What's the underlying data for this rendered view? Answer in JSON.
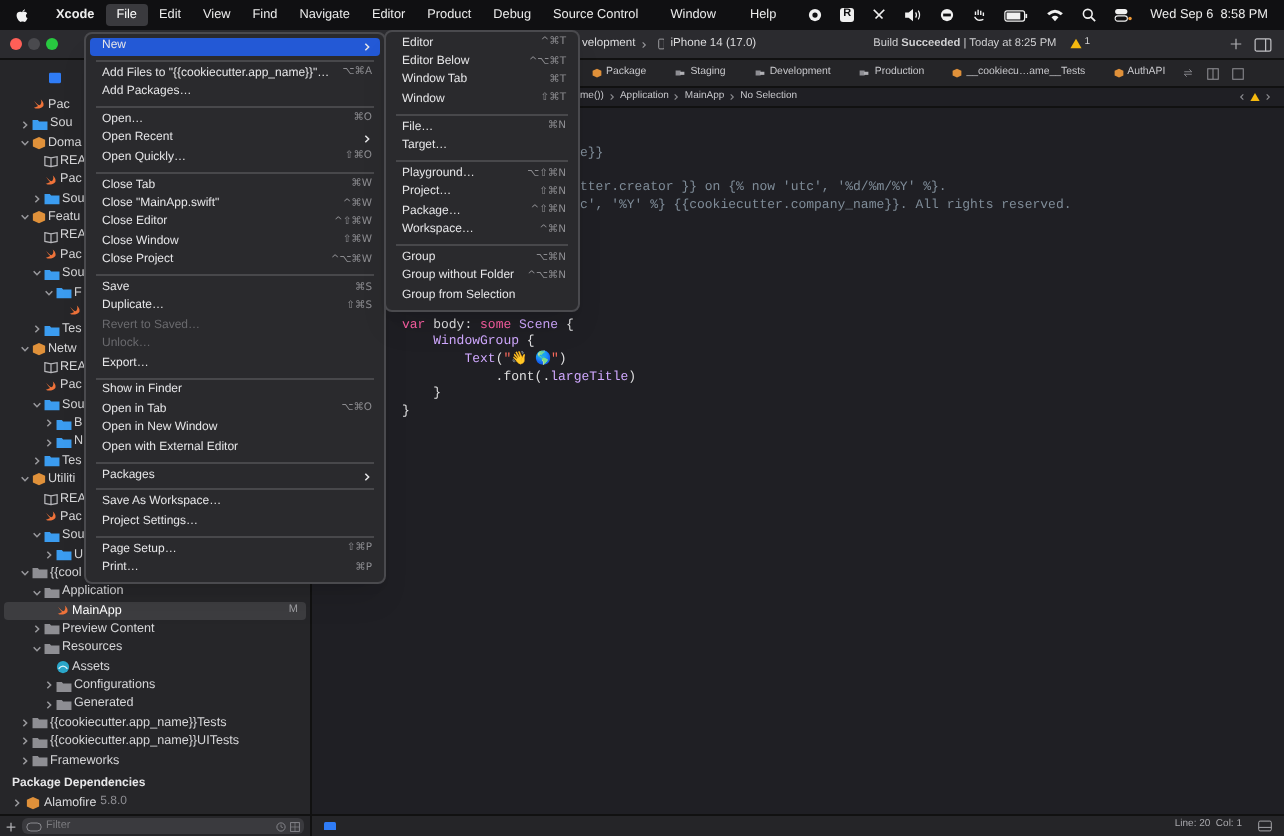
{
  "menubar": {
    "items": [
      {
        "label": "Xcode",
        "kind": "app",
        "selected": false
      },
      {
        "label": "File",
        "kind": "menu",
        "selected": true
      },
      {
        "label": "Edit",
        "kind": "menu",
        "selected": false
      },
      {
        "label": "View",
        "kind": "menu",
        "selected": false
      },
      {
        "label": "Find",
        "kind": "menu",
        "selected": false
      },
      {
        "label": "Navigate",
        "kind": "menu",
        "selected": false
      },
      {
        "label": "Editor",
        "kind": "menu",
        "selected": false
      },
      {
        "label": "Product",
        "kind": "menu",
        "selected": false
      },
      {
        "label": "Debug",
        "kind": "menu",
        "selected": false
      },
      {
        "label": "Source Control",
        "kind": "menu",
        "selected": false
      }
    ],
    "right_items": [
      "Window",
      "Help"
    ],
    "status_badge": "R",
    "clock": "Wed Sep 6  8:58 PM"
  },
  "toolbar": {
    "scheme": "velopment",
    "device": "iPhone 14 (17.0)",
    "build_status": "Build **Succeeded** | Today at 8:25 PM",
    "warnings": "1"
  },
  "file_menu": [
    {
      "kind": "item",
      "label": "New",
      "submenu": true,
      "disabled": false,
      "selected": true
    },
    {
      "kind": "separator"
    },
    {
      "kind": "item",
      "label": "Add Files to \"{{cookiecutter.app_name}}\"…",
      "shortcut": "⌥⌘A",
      "submenu": false,
      "disabled": false,
      "selected": false
    },
    {
      "kind": "item",
      "label": "Add Packages…",
      "submenu": false,
      "disabled": false,
      "selected": false
    },
    {
      "kind": "separator"
    },
    {
      "kind": "item",
      "label": "Open…",
      "shortcut": "⌘O",
      "submenu": false,
      "disabled": false,
      "selected": false
    },
    {
      "kind": "item",
      "label": "Open Recent",
      "submenu": true,
      "disabled": false,
      "selected": false
    },
    {
      "kind": "item",
      "label": "Open Quickly…",
      "shortcut": "⇧⌘O",
      "submenu": false,
      "disabled": false,
      "selected": false
    },
    {
      "kind": "separator"
    },
    {
      "kind": "item",
      "label": "Close Tab",
      "shortcut": "⌘W",
      "submenu": false,
      "disabled": false,
      "selected": false
    },
    {
      "kind": "item",
      "label": "Close \"MainApp.swift\"",
      "shortcut": "^⌘W",
      "submenu": false,
      "disabled": false,
      "selected": false
    },
    {
      "kind": "item",
      "label": "Close Editor",
      "shortcut": "^⇧⌘W",
      "submenu": false,
      "disabled": false,
      "selected": false
    },
    {
      "kind": "item",
      "label": "Close Window",
      "shortcut": "⇧⌘W",
      "submenu": false,
      "disabled": false,
      "selected": false
    },
    {
      "kind": "item",
      "label": "Close Project",
      "shortcut": "^⌥⌘W",
      "submenu": false,
      "disabled": false,
      "selected": false
    },
    {
      "kind": "separator"
    },
    {
      "kind": "item",
      "label": "Save",
      "shortcut": "⌘S",
      "submenu": false,
      "disabled": false,
      "selected": false
    },
    {
      "kind": "item",
      "label": "Duplicate…",
      "shortcut": "⇧⌘S",
      "submenu": false,
      "disabled": false,
      "selected": false
    },
    {
      "kind": "item",
      "label": "Revert to Saved…",
      "submenu": false,
      "disabled": true,
      "selected": false
    },
    {
      "kind": "item",
      "label": "Unlock…",
      "submenu": false,
      "disabled": true,
      "selected": false
    },
    {
      "kind": "item",
      "label": "Export…",
      "submenu": false,
      "disabled": false,
      "selected": false
    },
    {
      "kind": "separator"
    },
    {
      "kind": "item",
      "label": "Show in Finder",
      "submenu": false,
      "disabled": false,
      "selected": false
    },
    {
      "kind": "item",
      "label": "Open in Tab",
      "shortcut": "⌥⌘O",
      "submenu": false,
      "disabled": false,
      "selected": false
    },
    {
      "kind": "item",
      "label": "Open in New Window",
      "submenu": false,
      "disabled": false,
      "selected": false
    },
    {
      "kind": "item",
      "label": "Open with External Editor",
      "submenu": false,
      "disabled": false,
      "selected": false
    },
    {
      "kind": "separator"
    },
    {
      "kind": "item",
      "label": "Packages",
      "submenu": true,
      "disabled": false,
      "selected": false
    },
    {
      "kind": "separator"
    },
    {
      "kind": "item",
      "label": "Save As Workspace…",
      "submenu": false,
      "disabled": false,
      "selected": false
    },
    {
      "kind": "item",
      "label": "Project Settings…",
      "submenu": false,
      "disabled": false,
      "selected": false
    },
    {
      "kind": "separator"
    },
    {
      "kind": "item",
      "label": "Page Setup…",
      "shortcut": "⇧⌘P",
      "submenu": false,
      "disabled": false,
      "selected": false
    },
    {
      "kind": "item",
      "label": "Print…",
      "shortcut": "⌘P",
      "submenu": false,
      "disabled": false,
      "selected": false
    }
  ],
  "new_submenu": [
    {
      "kind": "item",
      "label": "Editor",
      "shortcut": "^⌘T"
    },
    {
      "kind": "item",
      "label": "Editor Below",
      "shortcut": "^⌥⌘T"
    },
    {
      "kind": "item",
      "label": "Window Tab",
      "shortcut": "⌘T"
    },
    {
      "kind": "item",
      "label": "Window",
      "shortcut": "⇧⌘T"
    },
    {
      "kind": "separator"
    },
    {
      "kind": "item",
      "label": "File…",
      "shortcut": "⌘N"
    },
    {
      "kind": "item",
      "label": "Target…"
    },
    {
      "kind": "separator"
    },
    {
      "kind": "item",
      "label": "Playground…",
      "shortcut": "⌥⇧⌘N"
    },
    {
      "kind": "item",
      "label": "Project…",
      "shortcut": "⇧⌘N"
    },
    {
      "kind": "item",
      "label": "Package…",
      "shortcut": "^⇧⌘N"
    },
    {
      "kind": "item",
      "label": "Workspace…",
      "shortcut": "^⌘N"
    },
    {
      "kind": "separator"
    },
    {
      "kind": "item",
      "label": "Group",
      "shortcut": "⌥⌘N"
    },
    {
      "kind": "item",
      "label": "Group without Folder",
      "shortcut": "^⌥⌘N"
    },
    {
      "kind": "item",
      "label": "Group from Selection"
    }
  ],
  "navigator": {
    "tree": [
      {
        "label": "Pac",
        "kind": "swift",
        "selected": false
      },
      {
        "label": "Sou",
        "kind": "folder",
        "expanded": false,
        "selected": false
      },
      {
        "label": "Doma",
        "kind": "module",
        "expanded": true,
        "selected": false,
        "children": [
          {
            "label": "REA",
            "kind": "readme",
            "selected": false
          },
          {
            "label": "Pac",
            "kind": "swift",
            "selected": false
          },
          {
            "label": "Sou",
            "kind": "folder",
            "expanded": false,
            "selected": false
          }
        ]
      },
      {
        "label": "Featu",
        "kind": "module",
        "expanded": true,
        "selected": false,
        "children": [
          {
            "label": "REA",
            "kind": "readme",
            "selected": false
          },
          {
            "label": "Pac",
            "kind": "swift",
            "selected": false
          },
          {
            "label": "Sou",
            "kind": "folder",
            "expanded": true,
            "selected": false,
            "children": [
              {
                "label": "F",
                "kind": "folder",
                "expanded": true,
                "selected": false,
                "children": [
                  {
                    "kind": "swift",
                    "selected": false
                  }
                ]
              }
            ]
          },
          {
            "label": "Tes",
            "kind": "folder",
            "expanded": false,
            "selected": false
          }
        ]
      },
      {
        "label": "Netw",
        "kind": "module",
        "expanded": true,
        "selected": false,
        "children": [
          {
            "label": "REA",
            "kind": "readme",
            "selected": false
          },
          {
            "label": "Pac",
            "kind": "swift",
            "selected": false
          },
          {
            "label": "Sou",
            "kind": "folder",
            "expanded": true,
            "selected": false,
            "children": [
              {
                "label": "B",
                "kind": "folder",
                "expanded": false,
                "selected": false
              },
              {
                "label": "N",
                "kind": "folder",
                "expanded": false,
                "selected": false
              }
            ]
          },
          {
            "label": "Tes",
            "kind": "folder",
            "expanded": false,
            "selected": false
          }
        ]
      },
      {
        "label": "Utiliti",
        "kind": "module",
        "expanded": true,
        "selected": false,
        "children": [
          {
            "label": "REA",
            "kind": "readme",
            "selected": false
          },
          {
            "label": "Pac",
            "kind": "swift",
            "selected": false
          },
          {
            "label": "Sou",
            "kind": "folder",
            "expanded": true,
            "selected": false,
            "children": [
              {
                "label": "U",
                "kind": "folder",
                "expanded": false,
                "selected": false
              }
            ]
          }
        ]
      },
      {
        "label": "{{cool",
        "kind": "group",
        "expanded": true,
        "selected": false,
        "children": [
          {
            "label": "Application",
            "kind": "group",
            "expanded": true,
            "selected": false,
            "children": [
              {
                "label": "MainApp",
                "kind": "swift",
                "selected": true,
                "badge": "M"
              }
            ]
          },
          {
            "label": "Preview Content",
            "kind": "group",
            "expanded": false,
            "selected": false
          },
          {
            "label": "Resources",
            "kind": "group",
            "expanded": true,
            "selected": false,
            "children": [
              {
                "label": "Assets",
                "kind": "assets",
                "selected": false
              },
              {
                "label": "Configurations",
                "kind": "group",
                "expanded": false,
                "selected": false
              },
              {
                "label": "Generated",
                "kind": "group",
                "expanded": false,
                "selected": false
              }
            ]
          }
        ]
      },
      {
        "label": "{{cookiecutter.app_name}}Tests",
        "kind": "group",
        "expanded": false,
        "selected": false
      },
      {
        "label": "{{cookiecutter.app_name}}UITests",
        "kind": "group",
        "expanded": false,
        "selected": false
      },
      {
        "label": "Frameworks",
        "kind": "group",
        "expanded": false,
        "selected": false
      }
    ],
    "dependencies_header": "Package Dependencies",
    "dependencies": [
      {
        "label": "Alamofire",
        "version": "5.8.0",
        "expanded": false
      }
    ],
    "filter": {
      "placeholder": "Filter"
    }
  },
  "editor": {
    "tabs": [
      {
        "label": "Package",
        "kind": "package"
      },
      {
        "label": "Staging",
        "kind": "scheme"
      },
      {
        "label": "Development",
        "kind": "scheme"
      },
      {
        "label": "Production",
        "kind": "scheme"
      },
      {
        "label": "__cookiecu…ame__Tests",
        "kind": "package"
      },
      {
        "label": "AuthAPI",
        "kind": "package"
      }
    ],
    "breadcrumb": [
      "me())",
      "Application",
      "MainApp",
      "No Selection"
    ],
    "top_lines": [
      {
        "segments": [
          {
            "kind": "comment",
            "text": "e}}"
          }
        ]
      },
      {
        "segments": [
          {
            "kind": "comment",
            "text": "tter.creator }} on {% now 'utc', '%d/%m/%Y' %}."
          }
        ]
      },
      {
        "segments": [
          {
            "kind": "comment",
            "text": "c', '%Y' %} {{cookiecutter.company_name}}. All rights reserved."
          }
        ]
      }
    ],
    "lines": [
      {
        "segments": [
          {
            "kind": "keyword",
            "text": "var"
          },
          {
            "kind": "plain",
            "text": " body: "
          },
          {
            "kind": "keyword",
            "text": "some "
          },
          {
            "kind": "type",
            "text": "Scene"
          },
          {
            "kind": "plain",
            "text": " {"
          }
        ]
      },
      {
        "segments": [
          {
            "kind": "type",
            "text": "    WindowGroup"
          },
          {
            "kind": "plain",
            "text": " {"
          }
        ]
      },
      {
        "segments": [
          {
            "kind": "type",
            "text": "        Text"
          },
          {
            "kind": "plain",
            "text": "("
          },
          {
            "kind": "string",
            "text": "\"👋 🌎\""
          },
          {
            "kind": "plain",
            "text": ")"
          }
        ]
      },
      {
        "segments": [
          {
            "kind": "plain",
            "text": "            .font(."
          },
          {
            "kind": "type",
            "text": "largeTitle"
          },
          {
            "kind": "plain",
            "text": ")"
          }
        ]
      },
      {
        "segments": [
          {
            "kind": "plain",
            "text": "    }"
          }
        ]
      },
      {
        "segments": [
          {
            "kind": "plain",
            "text": "}"
          }
        ]
      }
    ],
    "status": {
      "position": "Line: 20  Col: 1"
    }
  }
}
